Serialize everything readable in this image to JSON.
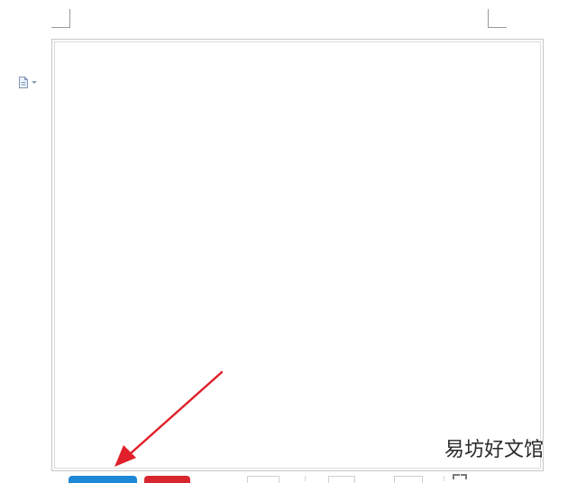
{
  "document": {
    "icons": {
      "margin_menu": "document-dropdown-icon",
      "crop_marks": "crop-corner-marks",
      "status_corner": "fullscreen-icon"
    }
  },
  "toolbar": {
    "primary_button_color": "#1e88d8",
    "secondary_button_color": "#d8262e"
  },
  "annotation": {
    "arrow_color": "#e0202a"
  },
  "watermark": {
    "text": "易坊好文馆"
  }
}
